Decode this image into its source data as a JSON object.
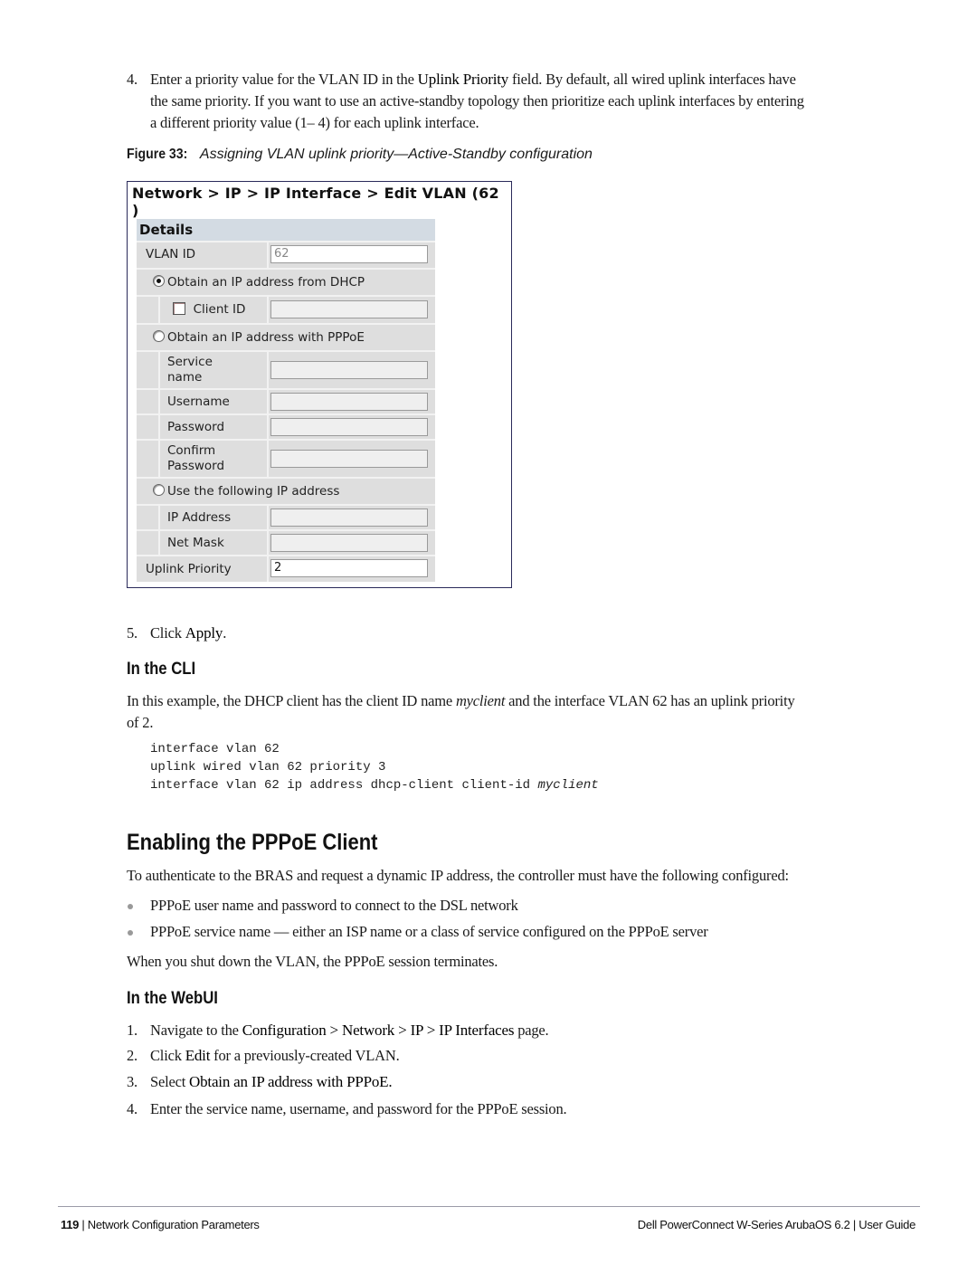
{
  "step4_top": {
    "num": "4.",
    "text_before": "Enter a priority value for the VLAN ID in the ",
    "bold": "Uplink Priority",
    "text_after_line1": " field. By default, all wired uplink interfaces have",
    "line2": "the same priority. If you want to use an active-standby topology then prioritize each uplink interfaces by entering",
    "line3": "a different priority value (1– 4) for each uplink interface."
  },
  "figure": {
    "label": "Figure 33:",
    "title": "Assigning VLAN uplink priority—Active-Standby configuration",
    "breadcrumb": "Network > IP > IP Interface > Edit VLAN (62 )",
    "details_header": "Details",
    "vlan_id_label": "VLAN ID",
    "vlan_id_value": "62",
    "radio_dhcp": "Obtain an IP address from DHCP",
    "client_id_label": "Client ID",
    "client_id_value": "",
    "radio_pppoe": "Obtain an IP address with PPPoE",
    "service_name_line1": "Service",
    "service_name_line2": "name",
    "service_name_value": "",
    "username_label": "Username",
    "username_value": "",
    "password_label": "Password",
    "password_value": "",
    "confirm_line1": "Confirm",
    "confirm_line2": "Password",
    "confirm_value": "",
    "radio_static": "Use the following IP address",
    "ip_address_label": "IP Address",
    "ip_address_value": "",
    "netmask_label": "Net Mask",
    "netmask_value": "",
    "uplink_priority_label": "Uplink Priority",
    "uplink_priority_value": "2",
    "selected_option": "dhcp",
    "client_id_checked": false
  },
  "step5": {
    "num": "5.",
    "text_before": "Click ",
    "bold": "Apply",
    "text_after": "."
  },
  "cli": {
    "heading": "In the CLI",
    "para_before": "In this example, the DHCP client has the client ID name ",
    "para_italic": "myclient",
    "para_after": " and the interface VLAN 62 has an uplink priority",
    "para_line2": "of 2.",
    "code": [
      "interface vlan 62",
      "uplink wired vlan 62 priority 3",
      "interface vlan 62 ip address dhcp-client client-id "
    ],
    "code_italic": "myclient"
  },
  "pppoe": {
    "heading": "Enabling the PPPoE Client",
    "intro": "To authenticate to the BRAS and request a dynamic IP address, the controller must have the following configured:",
    "bullets": [
      "PPPoE user name and password to connect to the DSL network",
      "PPPoE service name — either an ISP name or a class of service configured on the PPPoE server"
    ],
    "closing": "When you shut down the VLAN, the PPPoE session terminates."
  },
  "webui": {
    "heading": "In the WebUI",
    "steps": [
      {
        "num": "1.",
        "before": "Navigate to the ",
        "bold": "Configuration > Network > IP > IP Interfaces",
        "after": " page."
      },
      {
        "num": "2.",
        "before": "Click ",
        "bold": "Edit",
        "after": " for a previously-created VLAN."
      },
      {
        "num": "3.",
        "before": "Select ",
        "bold": "Obtain an IP address with PPPoE.",
        "after": ""
      },
      {
        "num": "4.",
        "before": "Enter the service name, username, and password for the PPPoE session.",
        "bold": "",
        "after": ""
      }
    ]
  },
  "footer": {
    "page_number": "119",
    "separator": " | ",
    "section": "Network Configuration Parameters",
    "guide_title": "Dell PowerConnect W-Series ArubaOS 6.2",
    "guide_sep": " | ",
    "guide_type": "User Guide"
  }
}
